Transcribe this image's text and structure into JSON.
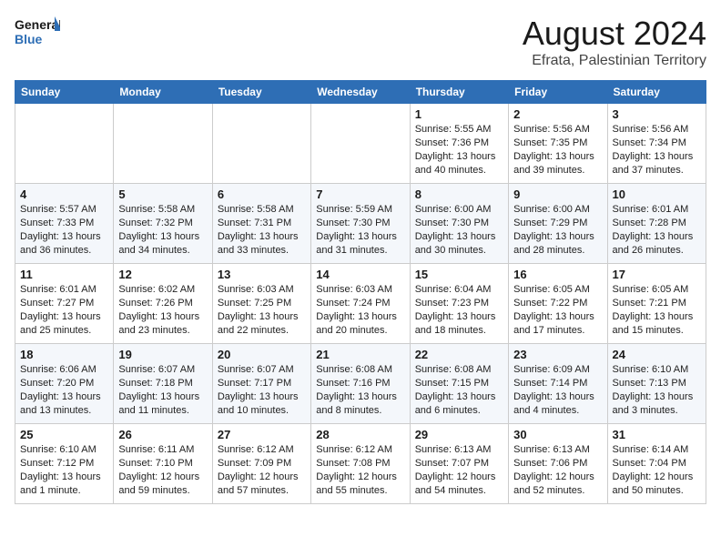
{
  "header": {
    "logo_general": "General",
    "logo_blue": "Blue",
    "month_year": "August 2024",
    "location": "Efrata, Palestinian Territory"
  },
  "days_of_week": [
    "Sunday",
    "Monday",
    "Tuesday",
    "Wednesday",
    "Thursday",
    "Friday",
    "Saturday"
  ],
  "weeks": [
    [
      {
        "num": "",
        "info": ""
      },
      {
        "num": "",
        "info": ""
      },
      {
        "num": "",
        "info": ""
      },
      {
        "num": "",
        "info": ""
      },
      {
        "num": "1",
        "info": "Sunrise: 5:55 AM\nSunset: 7:36 PM\nDaylight: 13 hours and 40 minutes."
      },
      {
        "num": "2",
        "info": "Sunrise: 5:56 AM\nSunset: 7:35 PM\nDaylight: 13 hours and 39 minutes."
      },
      {
        "num": "3",
        "info": "Sunrise: 5:56 AM\nSunset: 7:34 PM\nDaylight: 13 hours and 37 minutes."
      }
    ],
    [
      {
        "num": "4",
        "info": "Sunrise: 5:57 AM\nSunset: 7:33 PM\nDaylight: 13 hours and 36 minutes."
      },
      {
        "num": "5",
        "info": "Sunrise: 5:58 AM\nSunset: 7:32 PM\nDaylight: 13 hours and 34 minutes."
      },
      {
        "num": "6",
        "info": "Sunrise: 5:58 AM\nSunset: 7:31 PM\nDaylight: 13 hours and 33 minutes."
      },
      {
        "num": "7",
        "info": "Sunrise: 5:59 AM\nSunset: 7:30 PM\nDaylight: 13 hours and 31 minutes."
      },
      {
        "num": "8",
        "info": "Sunrise: 6:00 AM\nSunset: 7:30 PM\nDaylight: 13 hours and 30 minutes."
      },
      {
        "num": "9",
        "info": "Sunrise: 6:00 AM\nSunset: 7:29 PM\nDaylight: 13 hours and 28 minutes."
      },
      {
        "num": "10",
        "info": "Sunrise: 6:01 AM\nSunset: 7:28 PM\nDaylight: 13 hours and 26 minutes."
      }
    ],
    [
      {
        "num": "11",
        "info": "Sunrise: 6:01 AM\nSunset: 7:27 PM\nDaylight: 13 hours and 25 minutes."
      },
      {
        "num": "12",
        "info": "Sunrise: 6:02 AM\nSunset: 7:26 PM\nDaylight: 13 hours and 23 minutes."
      },
      {
        "num": "13",
        "info": "Sunrise: 6:03 AM\nSunset: 7:25 PM\nDaylight: 13 hours and 22 minutes."
      },
      {
        "num": "14",
        "info": "Sunrise: 6:03 AM\nSunset: 7:24 PM\nDaylight: 13 hours and 20 minutes."
      },
      {
        "num": "15",
        "info": "Sunrise: 6:04 AM\nSunset: 7:23 PM\nDaylight: 13 hours and 18 minutes."
      },
      {
        "num": "16",
        "info": "Sunrise: 6:05 AM\nSunset: 7:22 PM\nDaylight: 13 hours and 17 minutes."
      },
      {
        "num": "17",
        "info": "Sunrise: 6:05 AM\nSunset: 7:21 PM\nDaylight: 13 hours and 15 minutes."
      }
    ],
    [
      {
        "num": "18",
        "info": "Sunrise: 6:06 AM\nSunset: 7:20 PM\nDaylight: 13 hours and 13 minutes."
      },
      {
        "num": "19",
        "info": "Sunrise: 6:07 AM\nSunset: 7:18 PM\nDaylight: 13 hours and 11 minutes."
      },
      {
        "num": "20",
        "info": "Sunrise: 6:07 AM\nSunset: 7:17 PM\nDaylight: 13 hours and 10 minutes."
      },
      {
        "num": "21",
        "info": "Sunrise: 6:08 AM\nSunset: 7:16 PM\nDaylight: 13 hours and 8 minutes."
      },
      {
        "num": "22",
        "info": "Sunrise: 6:08 AM\nSunset: 7:15 PM\nDaylight: 13 hours and 6 minutes."
      },
      {
        "num": "23",
        "info": "Sunrise: 6:09 AM\nSunset: 7:14 PM\nDaylight: 13 hours and 4 minutes."
      },
      {
        "num": "24",
        "info": "Sunrise: 6:10 AM\nSunset: 7:13 PM\nDaylight: 13 hours and 3 minutes."
      }
    ],
    [
      {
        "num": "25",
        "info": "Sunrise: 6:10 AM\nSunset: 7:12 PM\nDaylight: 13 hours and 1 minute."
      },
      {
        "num": "26",
        "info": "Sunrise: 6:11 AM\nSunset: 7:10 PM\nDaylight: 12 hours and 59 minutes."
      },
      {
        "num": "27",
        "info": "Sunrise: 6:12 AM\nSunset: 7:09 PM\nDaylight: 12 hours and 57 minutes."
      },
      {
        "num": "28",
        "info": "Sunrise: 6:12 AM\nSunset: 7:08 PM\nDaylight: 12 hours and 55 minutes."
      },
      {
        "num": "29",
        "info": "Sunrise: 6:13 AM\nSunset: 7:07 PM\nDaylight: 12 hours and 54 minutes."
      },
      {
        "num": "30",
        "info": "Sunrise: 6:13 AM\nSunset: 7:06 PM\nDaylight: 12 hours and 52 minutes."
      },
      {
        "num": "31",
        "info": "Sunrise: 6:14 AM\nSunset: 7:04 PM\nDaylight: 12 hours and 50 minutes."
      }
    ]
  ]
}
